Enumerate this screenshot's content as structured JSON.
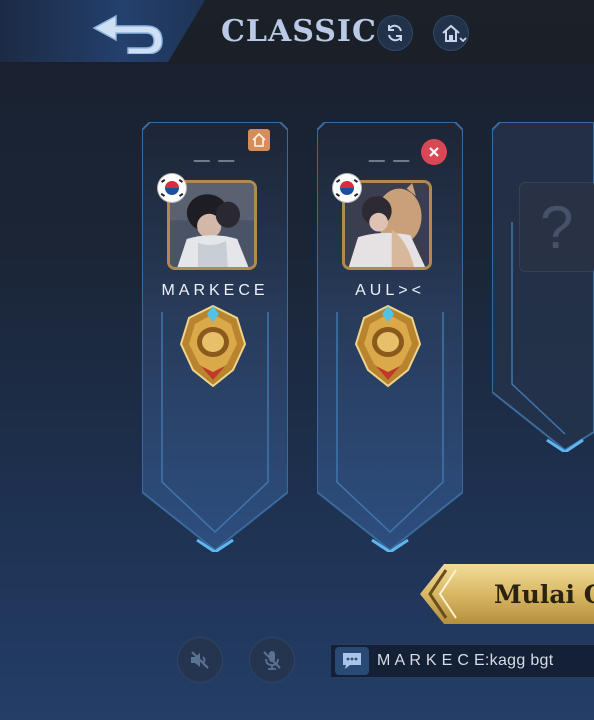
{
  "header": {
    "mode_title": "CLASSIC"
  },
  "lobby": {
    "players": [
      {
        "title": "— —",
        "name": "MARKECE",
        "country_flag": "south-korea",
        "rank": "mythic-gold-badge",
        "role": "host"
      },
      {
        "title": "— —",
        "name": "AUL><",
        "country_flag": "south-korea",
        "rank": "mythic-gold-badge",
        "role": "member"
      }
    ],
    "empty_slot_symbol": "?"
  },
  "actions": {
    "start_label": "Mulai G"
  },
  "chat": {
    "last_message": "M A R K E C E:kagg bgt"
  },
  "colors": {
    "accent_gold": "#d9b865",
    "frame_blue": "#3b6a9c",
    "kick_red": "#d94754",
    "host_orange": "#d38e5c"
  }
}
